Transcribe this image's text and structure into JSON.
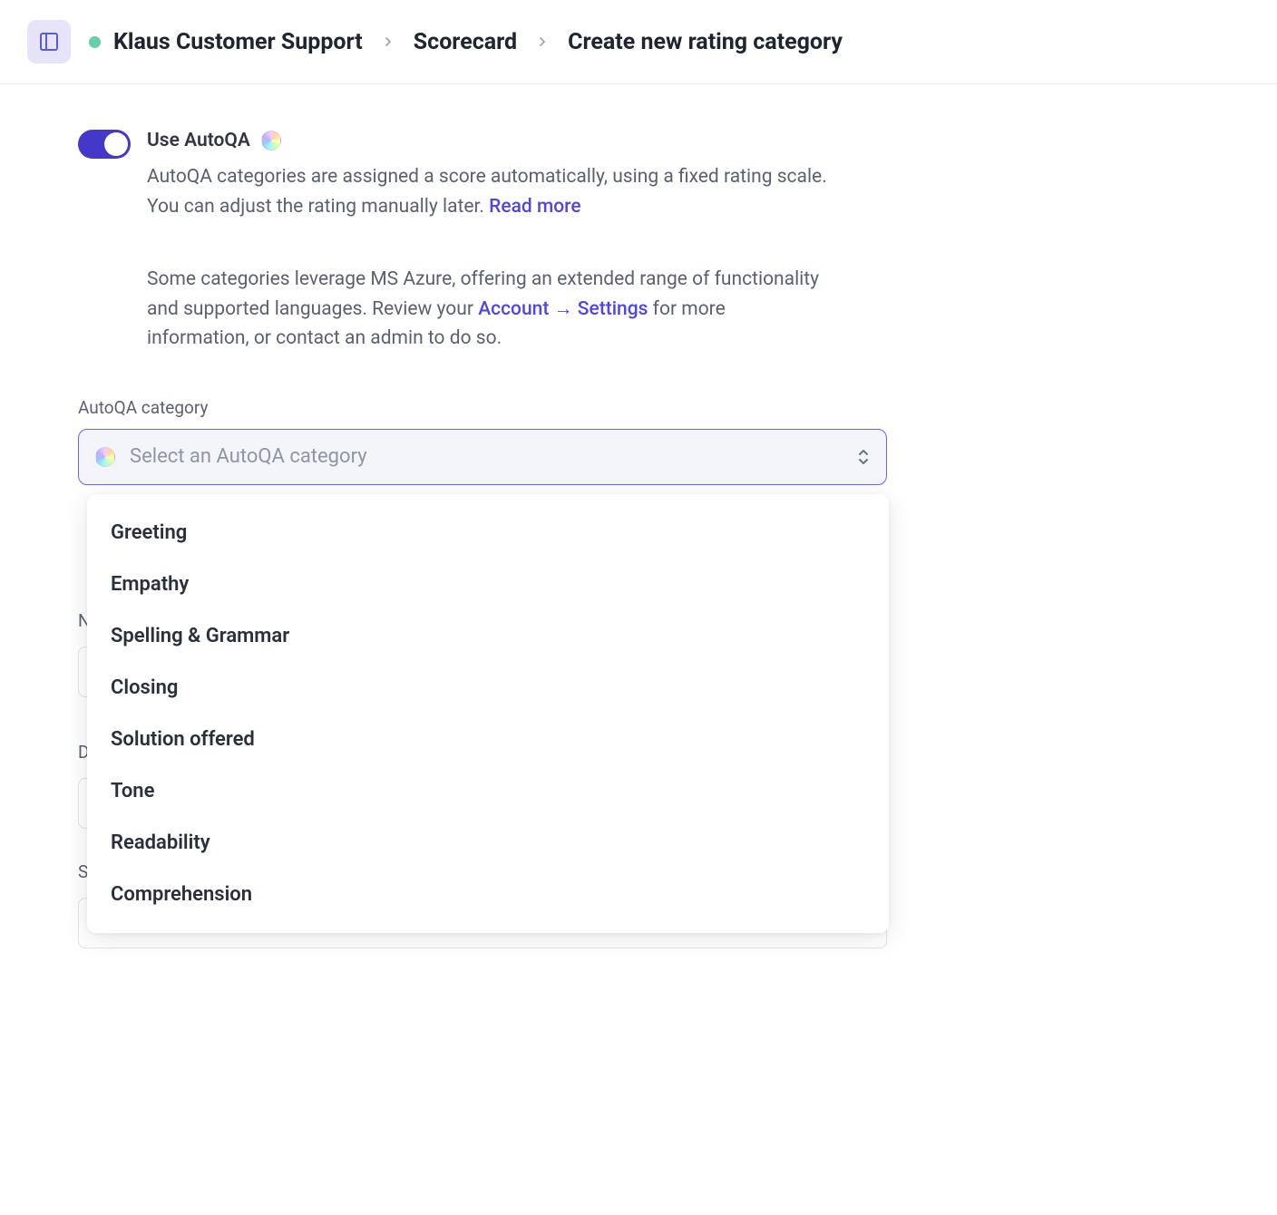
{
  "breadcrumb": {
    "item1": "Klaus Customer Support",
    "item2": "Scorecard",
    "item3": "Create new rating category"
  },
  "autoqa": {
    "toggle_label": "Use AutoQA",
    "desc1_a": "AutoQA categories are assigned a score automatically, using a fixed rating scale. You can adjust the rating manually later. ",
    "desc1_link": "Read more",
    "desc2_a": "Some categories leverage MS Azure, offering an extended range of functionality and supported languages. Review your ",
    "desc2_link": "Account → Settings",
    "desc2_b": " for more information, or contact an admin to do so."
  },
  "select": {
    "label": "AutoQA category",
    "placeholder": "Select an AutoQA category"
  },
  "options": {
    "o0": "Greeting",
    "o1": "Empathy",
    "o2": "Spelling & Grammar",
    "o3": "Closing",
    "o4": "Solution offered",
    "o5": "Tone",
    "o6": "Readability",
    "o7": "Comprehension"
  },
  "bg": {
    "label1": "N",
    "label2": "D",
    "label3": "S"
  }
}
